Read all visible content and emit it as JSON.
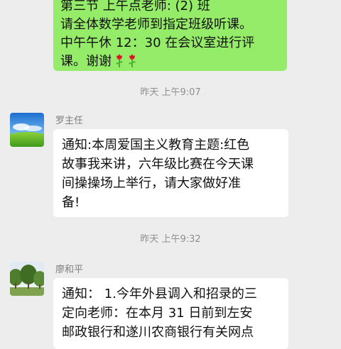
{
  "messages": [
    {
      "direction": "outgoing",
      "lines": [
        "第三节 上午点老师:      (2) 班",
        "请全体数学老师到指定班级听课。",
        "中午午休 12：30 在会议室进行评",
        "课。谢谢"
      ],
      "trailing_icons": [
        "rose-icon",
        "rose-icon"
      ]
    },
    {
      "timestamp": "昨天 上午9:07"
    },
    {
      "direction": "incoming",
      "sender": "罗主任",
      "avatar": "sky-meadow-avatar",
      "lines": [
        "通知:本周爱国主义教育主题:红色",
        "故事我来讲，六年级比赛在今天课",
        "间操操场上举行，请大家做好准",
        "备!"
      ]
    },
    {
      "timestamp": "昨天 上午9:32"
    },
    {
      "direction": "incoming",
      "sender": "廖和平",
      "avatar": "trees-avatar",
      "lines": [
        "通知： 1.今年外县调入和招录的三",
        "定向老师：在本月 31 日前到左安",
        "邮政银行和遂川农商银行有关网点"
      ]
    }
  ],
  "colors": {
    "background": "#ededed",
    "outgoing_bubble": "#95ec69",
    "incoming_bubble": "#ffffff",
    "timestamp_text": "#8e8e8e",
    "sender_text": "#7d7d7d"
  }
}
